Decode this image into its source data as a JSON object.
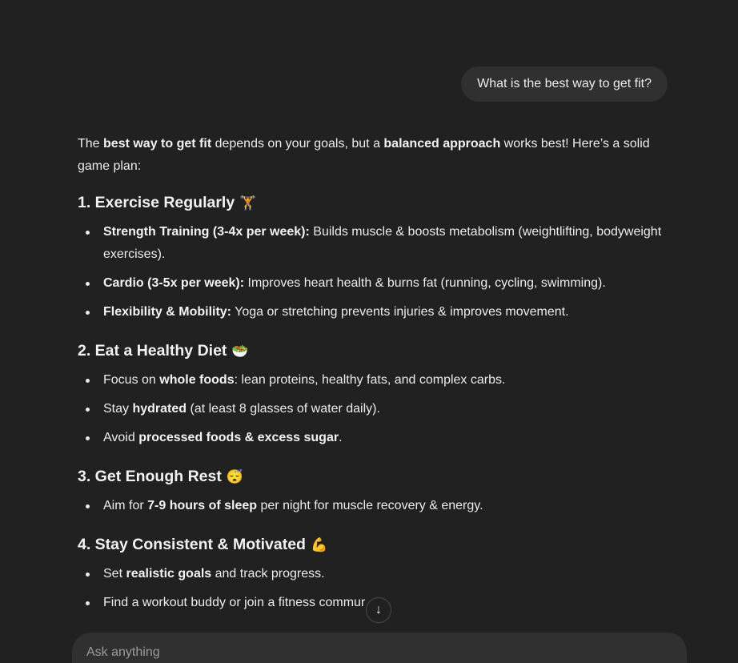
{
  "user_message": "What is the best way to get fit?",
  "answer": {
    "intro": {
      "t1": "The ",
      "b1": "best way to get fit",
      "t2": " depends on your goals, but a ",
      "b2": "balanced approach",
      "t3": " works best! Here’s a solid game plan:"
    },
    "sections": [
      {
        "heading": "1. Exercise Regularly",
        "emoji": "🏋️",
        "items": [
          {
            "bold": "Strength Training (3-4x per week):",
            "text": " Builds muscle & boosts metabolism (weightlifting, bodyweight exercises)."
          },
          {
            "bold": "Cardio (3-5x per week):",
            "text": " Improves heart health & burns fat (running, cycling, swimming)."
          },
          {
            "bold": "Flexibility & Mobility:",
            "text": " Yoga or stretching prevents injuries & improves movement."
          }
        ]
      },
      {
        "heading": "2. Eat a Healthy Diet",
        "emoji": "🥗",
        "items": [
          {
            "pre": "Focus on ",
            "bold": "whole foods",
            "post": ": lean proteins, healthy fats, and complex carbs."
          },
          {
            "pre": "Stay ",
            "bold": "hydrated",
            "post": " (at least 8 glasses of water daily)."
          },
          {
            "pre": "Avoid ",
            "bold": "processed foods & excess sugar",
            "post": "."
          }
        ]
      },
      {
        "heading": "3. Get Enough Rest",
        "emoji": "😴",
        "items": [
          {
            "pre": "Aim for ",
            "bold": "7-9 hours of sleep",
            "post": " per night for muscle recovery & energy."
          }
        ]
      },
      {
        "heading": "4. Stay Consistent & Motivated",
        "emoji": "💪",
        "items": [
          {
            "pre": "Set ",
            "bold": "realistic goals",
            "post": " and track progress."
          },
          {
            "pre": "",
            "bold": "",
            "post": "Find a workout buddy or join a fitness commur"
          }
        ]
      }
    ]
  },
  "scroll_down_icon": "arrow-down-icon",
  "scroll_down_glyph": "↓",
  "composer": {
    "placeholder": "Ask anything"
  }
}
